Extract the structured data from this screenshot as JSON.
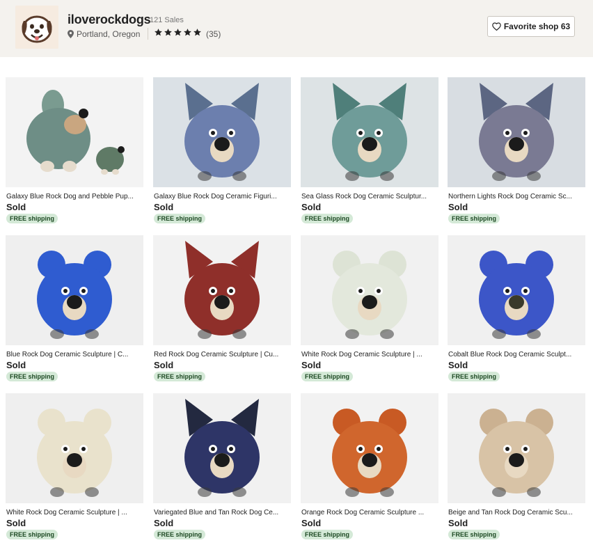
{
  "shop": {
    "name": "iloverockdogs",
    "sales": "121 Sales",
    "location": "Portland, Oregon",
    "rating": 5,
    "review_count": "(35)",
    "favorite_label": "Favorite shop 63"
  },
  "listings": [
    {
      "title": "Galaxy Blue Rock Dog and Pebble Pup...",
      "status": "Sold",
      "shipping": "FREE shipping",
      "bg": "#f3f3f3",
      "body": "#6e8e86",
      "ears": "#7a9b90",
      "nose": "#1b1b1b",
      "variant": "pair"
    },
    {
      "title": "Galaxy Blue Rock Dog Ceramic Figuri...",
      "status": "Sold",
      "shipping": "FREE shipping",
      "bg": "#dbe1e6",
      "body": "#6c7fae",
      "ears": "#5a6f8f",
      "nose": "#1b1b1b",
      "variant": "pointy"
    },
    {
      "title": "Sea Glass Rock Dog Ceramic Sculptur...",
      "status": "Sold",
      "shipping": "FREE shipping",
      "bg": "#dde3e5",
      "body": "#6f9c99",
      "ears": "#4f7f7a",
      "nose": "#1b1b1b",
      "variant": "pointy"
    },
    {
      "title": "Northern Lights Rock Dog Ceramic Sc...",
      "status": "Sold",
      "shipping": "FREE shipping",
      "bg": "#d8dde2",
      "body": "#7a7a93",
      "ears": "#5c6682",
      "nose": "#1b1b1b",
      "variant": "pointy"
    },
    {
      "title": "Blue Rock Dog Ceramic Sculpture | C...",
      "status": "Sold",
      "shipping": "FREE shipping",
      "bg": "#efefef",
      "body": "#2f5cd0",
      "ears": "#2f5cd0",
      "nose": "#1b1b1b",
      "variant": "round"
    },
    {
      "title": "Red Rock Dog Ceramic Sculpture | Cu...",
      "status": "Sold",
      "shipping": "FREE shipping",
      "bg": "#f2f2f2",
      "body": "#8f2f2a",
      "ears": "#8f2f2a",
      "nose": "#1b1b1b",
      "variant": "pointy"
    },
    {
      "title": "White Rock Dog Ceramic Sculpture | ...",
      "status": "Sold",
      "shipping": "FREE shipping",
      "bg": "#f1f1f1",
      "body": "#e3e8dc",
      "ears": "#dde3d5",
      "nose": "#1b1b1b",
      "variant": "round"
    },
    {
      "title": "Cobalt Blue Rock Dog Ceramic Sculpt...",
      "status": "Sold",
      "shipping": "FREE shipping",
      "bg": "#f0f0f0",
      "body": "#3c56c8",
      "ears": "#3c56c8",
      "nose": "#3a3a2a",
      "variant": "round"
    },
    {
      "title": "White Rock Dog Ceramic Sculpture | ...",
      "status": "Sold",
      "shipping": "FREE shipping",
      "bg": "#efefef",
      "body": "#e9e2cc",
      "ears": "#e9e2cc",
      "nose": "#1b1b1b",
      "variant": "round"
    },
    {
      "title": "Variegated Blue and Tan Rock Dog Ce...",
      "status": "Sold",
      "shipping": "FREE shipping",
      "bg": "#f1f1f1",
      "body": "#2e3567",
      "ears": "#232940",
      "nose": "#1b1b1b",
      "variant": "pointy"
    },
    {
      "title": "Orange Rock Dog Ceramic Sculpture ...",
      "status": "Sold",
      "shipping": "FREE shipping",
      "bg": "#f2f2f2",
      "body": "#d0662d",
      "ears": "#c85a24",
      "nose": "#1b1b1b",
      "variant": "round"
    },
    {
      "title": "Beige and Tan Rock Dog Ceramic Scu...",
      "status": "Sold",
      "shipping": "FREE shipping",
      "bg": "#f0f0f0",
      "body": "#d8c3a6",
      "ears": "#cbb191",
      "nose": "#1b1b1b",
      "variant": "round"
    }
  ],
  "colors": {
    "header_bg": "#f4f2ee",
    "shipping_badge_bg": "#d4e9d7",
    "shipping_badge_text": "#1e4a24"
  }
}
